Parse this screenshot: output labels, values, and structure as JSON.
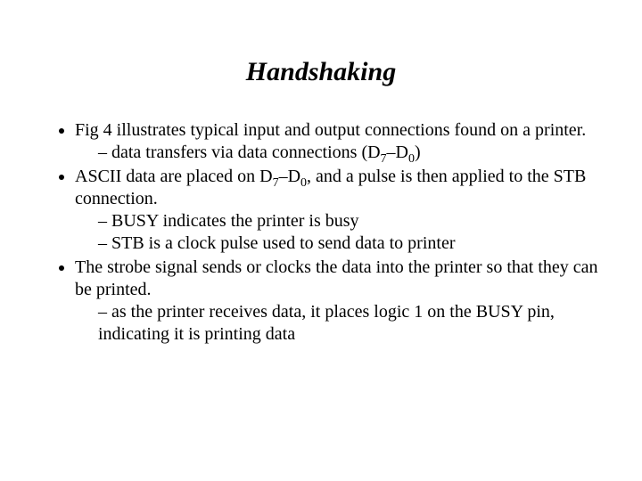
{
  "title": "Handshaking",
  "bullets": {
    "b1": "Fig 4 illustrates typical input and output connections found on a printer.",
    "b1a_pre": "data transfers via data connections (D",
    "b1a_sub1": "7",
    "b1a_mid": "–D",
    "b1a_sub2": "0",
    "b1a_post": ")",
    "b2_pre": "ASCII data are placed on D",
    "b2_sub1": "7",
    "b2_mid": "–D",
    "b2_sub2": "0",
    "b2_post": ", and a pulse is then applied to the STB connection.",
    "b2a": "BUSY indicates the printer is busy",
    "b2b": "STB is a clock pulse used to send data to printer",
    "b3": "The strobe signal sends or clocks the data into the printer so that they can be printed.",
    "b3a": "as the printer receives data, it places logic 1 on the BUSY pin, indicating it is printing data"
  }
}
